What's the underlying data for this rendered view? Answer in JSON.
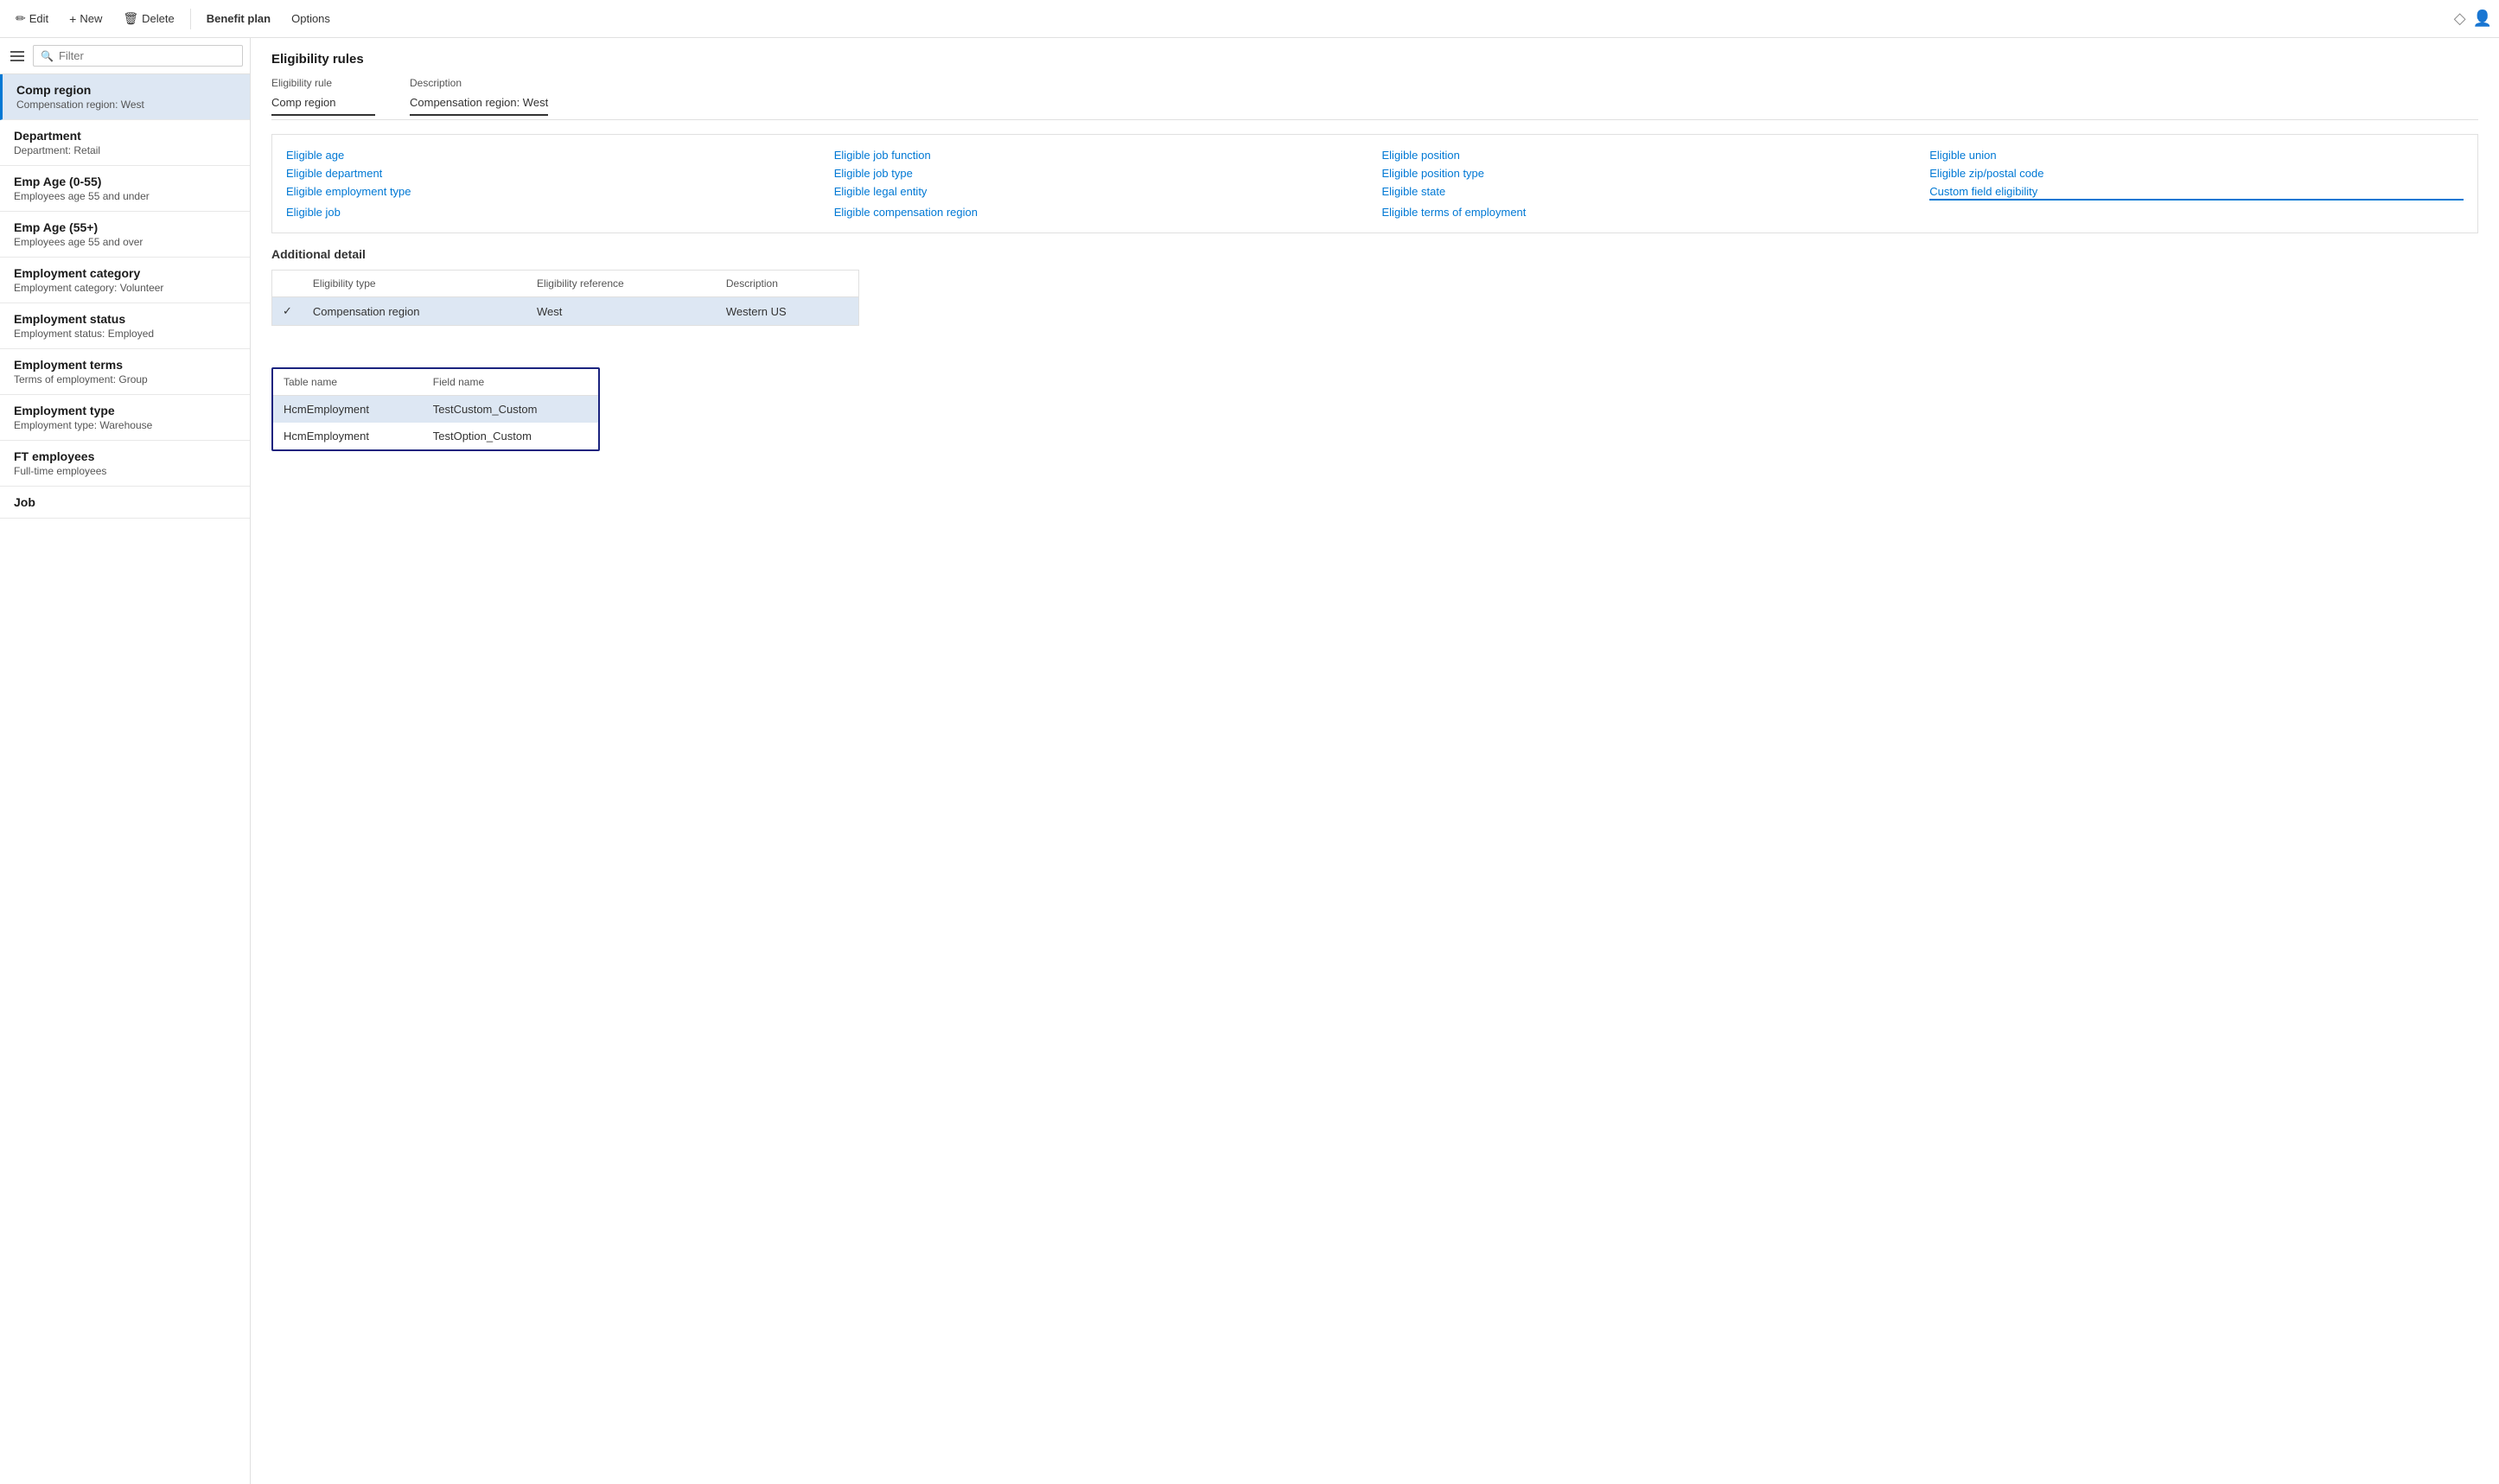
{
  "toolbar": {
    "edit_label": "Edit",
    "new_label": "New",
    "delete_label": "Delete",
    "benefit_plan_label": "Benefit plan",
    "options_label": "Options"
  },
  "sidebar": {
    "filter_placeholder": "Filter",
    "items": [
      {
        "title": "Comp region",
        "subtitle": "Compensation region:  West",
        "selected": true
      },
      {
        "title": "Department",
        "subtitle": "Department:  Retail",
        "selected": false
      },
      {
        "title": "Emp Age (0-55)",
        "subtitle": "Employees age 55 and under",
        "selected": false
      },
      {
        "title": "Emp Age (55+)",
        "subtitle": "Employees age 55 and over",
        "selected": false
      },
      {
        "title": "Employment category",
        "subtitle": "Employment category:  Volunteer",
        "selected": false
      },
      {
        "title": "Employment status",
        "subtitle": "Employment status:  Employed",
        "selected": false
      },
      {
        "title": "Employment terms",
        "subtitle": "Terms of employment:  Group",
        "selected": false
      },
      {
        "title": "Employment type",
        "subtitle": "Employment type:  Warehouse",
        "selected": false
      },
      {
        "title": "FT employees",
        "subtitle": "Full-time employees",
        "selected": false
      },
      {
        "title": "Job",
        "subtitle": "",
        "selected": false
      }
    ]
  },
  "eligibility_rules": {
    "section_title": "Eligibility rules",
    "col1_label": "Eligibility rule",
    "col1_value": "Comp region",
    "col2_label": "Description",
    "col2_value": "Compensation region:  West"
  },
  "links": [
    {
      "col": 0,
      "text": "Eligible age"
    },
    {
      "col": 0,
      "text": "Eligible department"
    },
    {
      "col": 0,
      "text": "Eligible employment type"
    },
    {
      "col": 0,
      "text": "Eligible job"
    },
    {
      "col": 1,
      "text": "Eligible job function"
    },
    {
      "col": 1,
      "text": "Eligible job type"
    },
    {
      "col": 1,
      "text": "Eligible legal entity"
    },
    {
      "col": 1,
      "text": "Eligible compensation region"
    },
    {
      "col": 2,
      "text": "Eligible position"
    },
    {
      "col": 2,
      "text": "Eligible position type"
    },
    {
      "col": 2,
      "text": "Eligible state"
    },
    {
      "col": 2,
      "text": "Eligible terms of employment"
    },
    {
      "col": 3,
      "text": "Eligible union"
    },
    {
      "col": 3,
      "text": "Eligible zip/postal code"
    },
    {
      "col": 3,
      "text": "Custom field eligibility",
      "highlighted": true
    }
  ],
  "additional_detail": {
    "title": "Additional detail",
    "table": {
      "headers": [
        "",
        "Eligibility type",
        "Eligibility reference",
        "Description"
      ],
      "rows": [
        {
          "check": "✓",
          "type": "Compensation region",
          "reference": "West",
          "description": "Western US",
          "selected": true
        }
      ]
    }
  },
  "custom_fields": {
    "table": {
      "headers": [
        "Table name",
        "Field name"
      ],
      "rows": [
        {
          "table": "HcmEmployment",
          "field": "TestCustom_Custom",
          "selected": true
        },
        {
          "table": "HcmEmployment",
          "field": "TestOption_Custom",
          "selected": false
        }
      ]
    }
  },
  "icons": {
    "edit": "✏",
    "new": "+",
    "delete": "🗑",
    "options": "⚙",
    "search": "🔍",
    "filter": "⚗",
    "diamond": "◇",
    "user": "👤",
    "hamburger": "☰"
  }
}
